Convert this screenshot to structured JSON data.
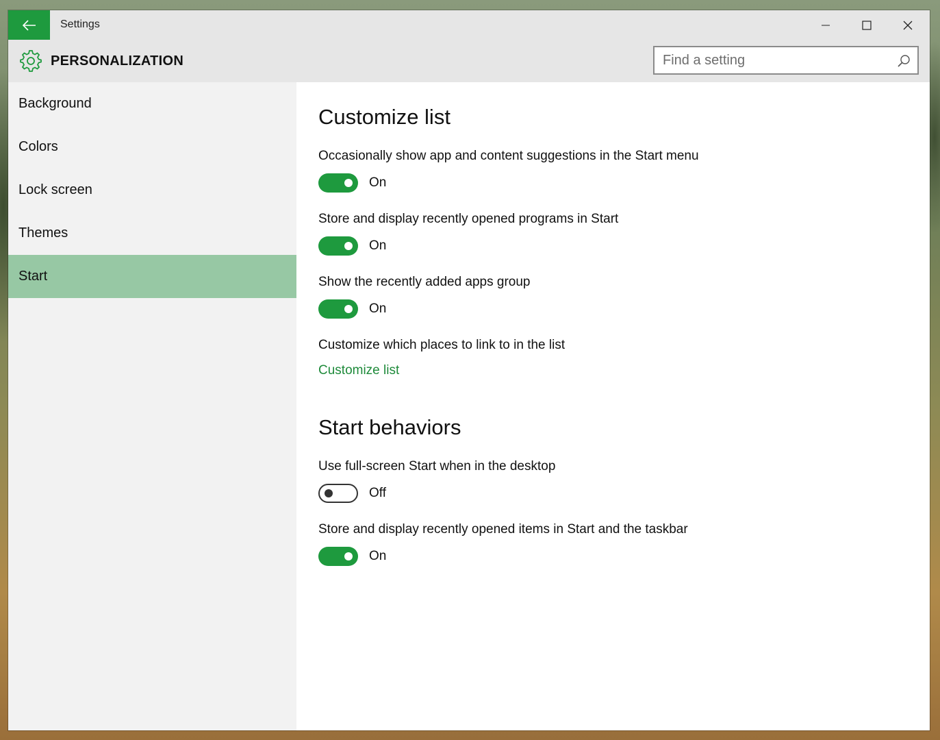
{
  "window": {
    "title": "Settings",
    "controls": {
      "minimize": "minimize-icon",
      "maximize": "maximize-icon",
      "close": "close-icon"
    }
  },
  "header": {
    "icon": "gear-icon",
    "title": "PERSONALIZATION",
    "search_placeholder": "Find a setting"
  },
  "sidebar": {
    "items": [
      {
        "label": "Background"
      },
      {
        "label": "Colors"
      },
      {
        "label": "Lock screen"
      },
      {
        "label": "Themes"
      },
      {
        "label": "Start",
        "selected": true
      }
    ]
  },
  "content": {
    "section1": {
      "title": "Customize list",
      "settings": [
        {
          "label": "Occasionally show app and content suggestions in the Start menu",
          "state": "On"
        },
        {
          "label": "Store and display recently opened programs in Start",
          "state": "On"
        },
        {
          "label": "Show the recently added apps group",
          "state": "On"
        }
      ],
      "link_label": "Customize which places to link to in the list",
      "link_text": "Customize list"
    },
    "section2": {
      "title": "Start behaviors",
      "settings": [
        {
          "label": "Use full-screen Start when in the desktop",
          "state": "Off"
        },
        {
          "label": "Store and display recently opened items in Start and the taskbar",
          "state": "On"
        }
      ]
    }
  },
  "colors": {
    "accent": "#1e9a3e",
    "selected_nav": "#97c8a4",
    "link": "#1e8a3a"
  }
}
